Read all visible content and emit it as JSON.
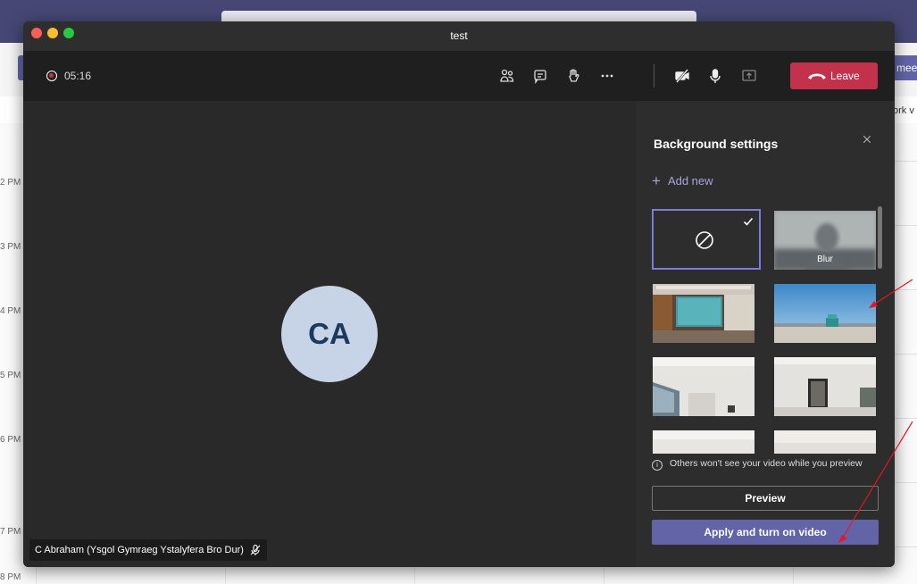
{
  "window": {
    "title": "test"
  },
  "meeting_bar": {
    "timer": "05:16",
    "controls": [
      {
        "name": "participants-icon"
      },
      {
        "name": "chat-icon"
      },
      {
        "name": "raise-hand-icon"
      },
      {
        "name": "more-options-icon"
      },
      {
        "name": "camera-off-icon"
      },
      {
        "name": "microphone-icon"
      },
      {
        "name": "share-screen-icon"
      }
    ],
    "leave_label": "Leave"
  },
  "stage": {
    "avatar_initials": "CA",
    "participant_name": "C Abraham (Ysgol Gymraeg Ystalyfera Bro Dur)"
  },
  "panel": {
    "title": "Background settings",
    "add_new_label": "Add new",
    "blur_label": "Blur",
    "info_text": "Others won't see your video while you preview",
    "preview_label": "Preview",
    "apply_label": "Apply and turn on video"
  },
  "background_calendar": {
    "hours": [
      "2 PM",
      "3 PM",
      "4 PM",
      "5 PM",
      "6 PM",
      "7 PM",
      "8 PM"
    ],
    "meet_button_fragment": "mee",
    "work_fragment": "ork v"
  },
  "colors": {
    "accent": "#6264a7",
    "leave": "#c4314b",
    "annotation_arrow": "#e8141e"
  }
}
